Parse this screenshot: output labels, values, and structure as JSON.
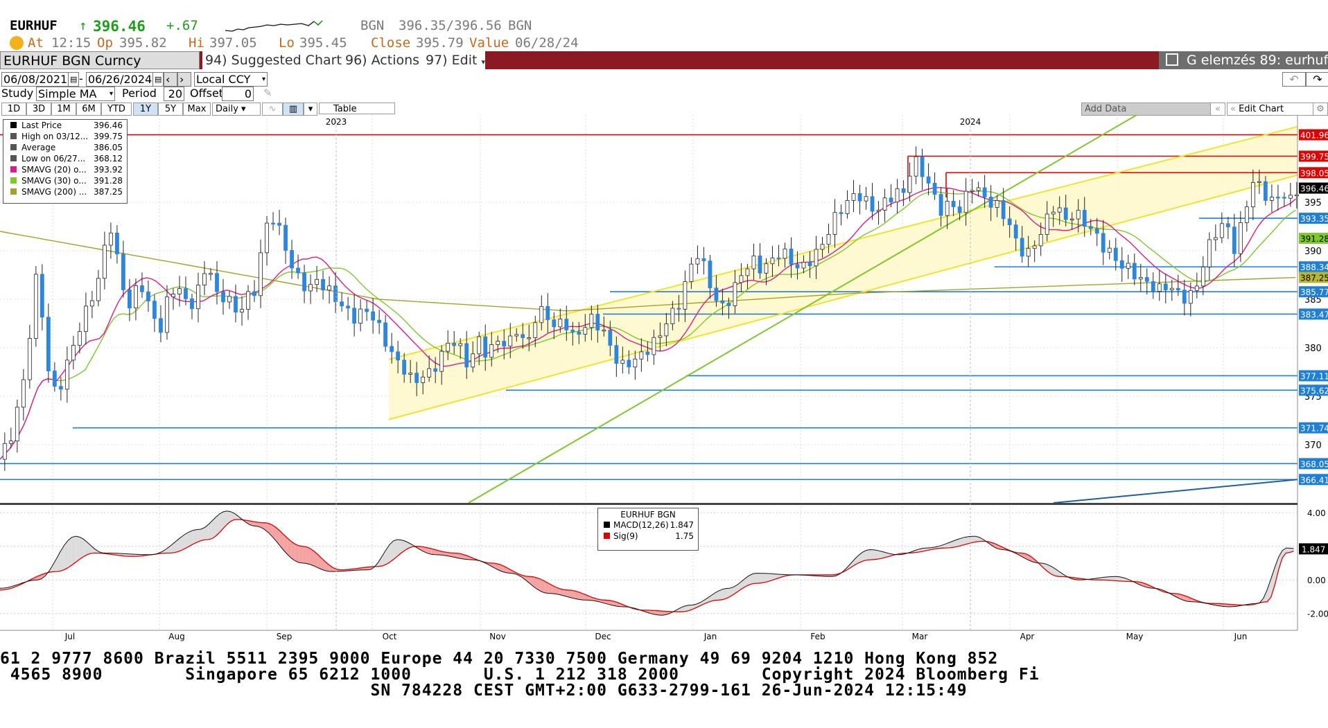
{
  "quote": {
    "ticker": "EURHUF",
    "arrow": "↑",
    "last": "396.46",
    "change": "+.67",
    "source": "BGN",
    "bid_ask": "396.35/396.56",
    "source2": "BGN",
    "at_label": "At",
    "at_time": "12:15",
    "op_label": "Op",
    "op": "395.82",
    "hi_label": "Hi",
    "hi": "397.05",
    "lo_label": "Lo",
    "lo": "395.45",
    "close_label": "Close",
    "close": "395.79",
    "value_label": "Value",
    "value": "06/28/24"
  },
  "toolbar": {
    "security": "EURHUF BGN Curncy",
    "suggested": "94) Suggested Charts",
    "actions": "96) Actions",
    "edit": "97) Edit",
    "analysis": "G elemzés 89: eurhuf"
  },
  "controls": {
    "start_date": "06/08/2021",
    "end_date": "06/26/2024",
    "currency": "Local CCY",
    "study_label": "Study",
    "study_value": "Simple MA",
    "period_label": "Period",
    "period_value": "20",
    "offset_label": "Offset",
    "offset_value": "0",
    "periods": [
      "1D",
      "3D",
      "1M",
      "6M",
      "YTD",
      "1Y",
      "5Y",
      "Max"
    ],
    "active_period": "1Y",
    "frequency": "Daily",
    "table": "Table",
    "add_data": "Add Data",
    "edit_chart": "Edit Chart"
  },
  "legend": {
    "rows": [
      {
        "label": "Last Price",
        "value": "396.46",
        "color": "#000000"
      },
      {
        "label": "High on 03/12...",
        "value": "399.75",
        "color": "#555555"
      },
      {
        "label": "Average",
        "value": "386.05",
        "color": "#555555"
      },
      {
        "label": "Low on 06/27...",
        "value": "368.12",
        "color": "#555555"
      },
      {
        "label": "SMAVG (20)  o...",
        "value": "393.92",
        "color": "#e0198c"
      },
      {
        "label": "SMAVG (30)  o...",
        "value": "391.28",
        "color": "#7ec829"
      },
      {
        "label": "SMAVG (200) ...",
        "value": "387.25",
        "color": "#a3a327"
      }
    ]
  },
  "macd_legend": {
    "title": "EURHUF BGN",
    "rows": [
      {
        "label": "MACD(12,26)",
        "value": "1.847",
        "color": "#000000"
      },
      {
        "label": "Sig(9)",
        "value": "1.75",
        "color": "#e00000"
      }
    ]
  },
  "chart_data": {
    "type": "line",
    "title": "EURHUF BGN Curncy",
    "price_axis": {
      "ylim": [
        364,
        404
      ],
      "ticks": [
        370,
        375,
        380,
        385,
        390,
        395
      ]
    },
    "price_labels": [
      {
        "value": 401.96,
        "text": "401.96",
        "color": "#e00000"
      },
      {
        "value": 399.75,
        "text": "399.75",
        "color": "#e00000"
      },
      {
        "value": 398.05,
        "text": "398.05",
        "color": "#e00000"
      },
      {
        "value": 396.46,
        "text": "396.46",
        "color": "#000000"
      },
      {
        "value": 393.35,
        "text": "393.35",
        "color": "#1e7fd6"
      },
      {
        "value": 391.28,
        "text": "391.28",
        "color": "#7ec829"
      },
      {
        "value": 388.34,
        "text": "388.34",
        "color": "#1e7fd6"
      },
      {
        "value": 387.25,
        "text": "387.25",
        "color": "#b8b830"
      },
      {
        "value": 385.77,
        "text": "385.77",
        "color": "#1e7fd6"
      },
      {
        "value": 383.47,
        "text": "383.47",
        "color": "#1e7fd6"
      },
      {
        "value": 377.11,
        "text": "377.11",
        "color": "#1e7fd6"
      },
      {
        "value": 375.62,
        "text": "375.62",
        "color": "#1e7fd6"
      },
      {
        "value": 371.74,
        "text": "371.74",
        "color": "#1e7fd6"
      },
      {
        "value": 368.05,
        "text": "368.05",
        "color": "#1e7fd6"
      },
      {
        "value": 366.41,
        "text": "366.41",
        "color": "#1e7fd6"
      }
    ],
    "months": [
      "Jul",
      "Aug",
      "Sep",
      "Oct",
      "Nov",
      "Dec",
      "Jan",
      "Feb",
      "Mar",
      "Apr",
      "May",
      "Jun"
    ],
    "years": [
      "2023",
      "2024"
    ],
    "price": [
      {
        "t": 0.0,
        "v": 368.5
      },
      {
        "t": 0.6,
        "v": 371
      },
      {
        "t": 1.3,
        "v": 377
      },
      {
        "t": 1.9,
        "v": 387
      },
      {
        "t": 2.2,
        "v": 384
      },
      {
        "t": 2.6,
        "v": 377
      },
      {
        "t": 3.0,
        "v": 375
      },
      {
        "t": 3.5,
        "v": 378
      },
      {
        "t": 4.0,
        "v": 381
      },
      {
        "t": 4.6,
        "v": 384
      },
      {
        "t": 5.2,
        "v": 387
      },
      {
        "t": 5.8,
        "v": 393
      },
      {
        "t": 6.3,
        "v": 388
      },
      {
        "t": 6.8,
        "v": 384
      },
      {
        "t": 7.4,
        "v": 387
      },
      {
        "t": 8.0,
        "v": 383.5
      },
      {
        "t": 8.5,
        "v": 382
      },
      {
        "t": 9.0,
        "v": 386
      },
      {
        "t": 9.5,
        "v": 386
      },
      {
        "t": 10.0,
        "v": 384
      },
      {
        "t": 10.5,
        "v": 386
      },
      {
        "t": 11.0,
        "v": 389
      },
      {
        "t": 11.5,
        "v": 385
      },
      {
        "t": 12.0,
        "v": 385.5
      },
      {
        "t": 12.6,
        "v": 383
      },
      {
        "t": 13.0,
        "v": 386
      },
      {
        "t": 13.3,
        "v": 384
      },
      {
        "t": 13.8,
        "v": 390
      },
      {
        "t": 14.3,
        "v": 394
      },
      {
        "t": 14.8,
        "v": 392
      },
      {
        "t": 15.3,
        "v": 389
      },
      {
        "t": 15.8,
        "v": 387
      },
      {
        "t": 16.3,
        "v": 386
      },
      {
        "t": 16.8,
        "v": 387
      },
      {
        "t": 17.3,
        "v": 386
      },
      {
        "t": 17.8,
        "v": 385
      },
      {
        "t": 18.2,
        "v": 384
      },
      {
        "t": 18.8,
        "v": 383
      },
      {
        "t": 19.3,
        "v": 384
      },
      {
        "t": 19.8,
        "v": 383
      },
      {
        "t": 20.3,
        "v": 381
      },
      {
        "t": 20.8,
        "v": 379
      },
      {
        "t": 21.3,
        "v": 378
      },
      {
        "t": 21.8,
        "v": 376.5
      },
      {
        "t": 22.3,
        "v": 377
      },
      {
        "t": 22.8,
        "v": 377.5
      },
      {
        "t": 23.3,
        "v": 379
      },
      {
        "t": 23.8,
        "v": 381
      },
      {
        "t": 24.3,
        "v": 380
      },
      {
        "t": 24.8,
        "v": 378
      },
      {
        "t": 25.3,
        "v": 381
      },
      {
        "t": 25.8,
        "v": 379
      },
      {
        "t": 26.3,
        "v": 381
      },
      {
        "t": 26.8,
        "v": 380
      },
      {
        "t": 27.3,
        "v": 382
      },
      {
        "t": 27.8,
        "v": 380
      },
      {
        "t": 28.3,
        "v": 383
      },
      {
        "t": 28.8,
        "v": 384
      },
      {
        "t": 29.3,
        "v": 382
      },
      {
        "t": 29.8,
        "v": 383
      },
      {
        "t": 30.3,
        "v": 381
      },
      {
        "t": 30.8,
        "v": 382
      },
      {
        "t": 31.3,
        "v": 383
      },
      {
        "t": 31.8,
        "v": 382
      },
      {
        "t": 32.3,
        "v": 380
      },
      {
        "t": 32.8,
        "v": 378
      },
      {
        "t": 33.3,
        "v": 378.5
      },
      {
        "t": 33.8,
        "v": 379
      },
      {
        "t": 34.3,
        "v": 380
      },
      {
        "t": 34.8,
        "v": 381
      },
      {
        "t": 35.3,
        "v": 383
      },
      {
        "t": 35.8,
        "v": 384
      },
      {
        "t": 36.3,
        "v": 387
      },
      {
        "t": 36.8,
        "v": 390
      },
      {
        "t": 37.3,
        "v": 388
      },
      {
        "t": 37.8,
        "v": 385
      },
      {
        "t": 38.3,
        "v": 384
      },
      {
        "t": 38.8,
        "v": 386
      },
      {
        "t": 39.3,
        "v": 388
      },
      {
        "t": 39.8,
        "v": 389
      },
      {
        "t": 40.3,
        "v": 388
      },
      {
        "t": 40.8,
        "v": 389
      },
      {
        "t": 41.3,
        "v": 390
      },
      {
        "t": 41.8,
        "v": 389
      },
      {
        "t": 42.3,
        "v": 388
      },
      {
        "t": 42.8,
        "v": 389
      },
      {
        "t": 43.3,
        "v": 390
      },
      {
        "t": 43.8,
        "v": 392
      },
      {
        "t": 44.3,
        "v": 394
      },
      {
        "t": 44.8,
        "v": 395
      },
      {
        "t": 45.3,
        "v": 396
      },
      {
        "t": 45.8,
        "v": 395
      },
      {
        "t": 46.3,
        "v": 394
      },
      {
        "t": 46.8,
        "v": 395
      },
      {
        "t": 47.3,
        "v": 396
      },
      {
        "t": 47.8,
        "v": 396
      },
      {
        "t": 48.3,
        "v": 399.5
      },
      {
        "t": 48.8,
        "v": 398
      },
      {
        "t": 49.3,
        "v": 396
      },
      {
        "t": 49.8,
        "v": 394
      },
      {
        "t": 50.3,
        "v": 395
      },
      {
        "t": 50.8,
        "v": 394
      },
      {
        "t": 51.3,
        "v": 397
      },
      {
        "t": 51.8,
        "v": 396
      },
      {
        "t": 52.3,
        "v": 395
      },
      {
        "t": 52.8,
        "v": 394.5
      },
      {
        "t": 53.3,
        "v": 393
      },
      {
        "t": 53.8,
        "v": 390.5
      },
      {
        "t": 54.3,
        "v": 389.5
      },
      {
        "t": 54.8,
        "v": 391
      },
      {
        "t": 55.3,
        "v": 393
      },
      {
        "t": 55.8,
        "v": 395
      },
      {
        "t": 56.3,
        "v": 393
      },
      {
        "t": 56.8,
        "v": 394
      },
      {
        "t": 57.3,
        "v": 393
      },
      {
        "t": 57.8,
        "v": 392
      },
      {
        "t": 58.3,
        "v": 390.5
      },
      {
        "t": 58.8,
        "v": 389.5
      },
      {
        "t": 59.3,
        "v": 388.5
      },
      {
        "t": 59.8,
        "v": 388
      },
      {
        "t": 60.3,
        "v": 387
      },
      {
        "t": 60.8,
        "v": 386.5
      },
      {
        "t": 61.3,
        "v": 386
      },
      {
        "t": 61.8,
        "v": 386.5
      },
      {
        "t": 62.3,
        "v": 385.5
      },
      {
        "t": 62.8,
        "v": 385
      },
      {
        "t": 63.3,
        "v": 386.5
      },
      {
        "t": 63.8,
        "v": 390
      },
      {
        "t": 64.3,
        "v": 392
      },
      {
        "t": 64.8,
        "v": 393
      },
      {
        "t": 65.3,
        "v": 390
      },
      {
        "t": 65.8,
        "v": 394
      },
      {
        "t": 66.3,
        "v": 397.5
      },
      {
        "t": 66.8,
        "v": 396
      },
      {
        "t": 67.3,
        "v": 395
      },
      {
        "t": 67.8,
        "v": 396
      },
      {
        "t": 68.3,
        "v": 395
      },
      {
        "t": 68.6,
        "v": 396.46
      }
    ],
    "sma20_end": 393.92,
    "sma30_end": 391.28,
    "sma200_end": 387.25,
    "macd": {
      "ylim": [
        -3,
        4.5
      ],
      "ticks": [
        4.0,
        2.0,
        0.0,
        -2.0
      ],
      "tick_labels": [
        "4.00",
        "2.00",
        "0.00",
        "-2.00"
      ],
      "last_label": "1.847"
    }
  },
  "footer": {
    "line1": "61 2 9777 8600 Brazil 5511 2395 9000 Europe 44 20 7330 7500 Germany 49 69 9204 1210 Hong Kong 852",
    "line2": " 4565 8900        Singapore 65 6212 1000       U.S. 1 212 318 2000        Copyright 2024 Bloomberg Fi",
    "line3": "                                    SN 784228 CEST GMT+2:00 G633-2799-161 26-Jun-2024 12:15:49"
  }
}
